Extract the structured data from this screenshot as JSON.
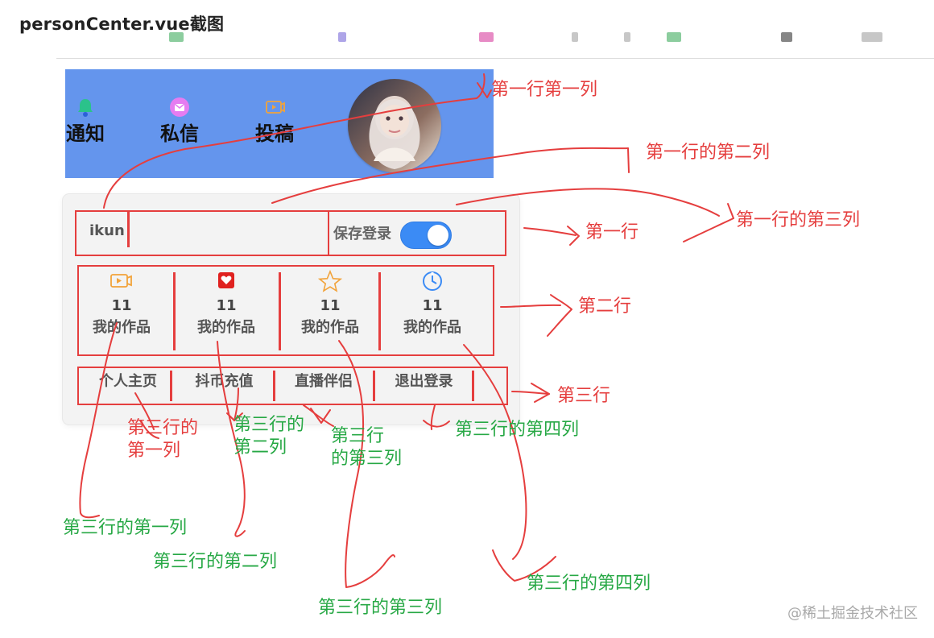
{
  "doc": {
    "title": "personCenter.vue截图"
  },
  "header": {
    "items": [
      {
        "label": "通知",
        "icon": "bell-icon"
      },
      {
        "label": "私信",
        "icon": "message-icon"
      },
      {
        "label": "投稿",
        "icon": "video-upload-icon"
      }
    ],
    "avatar": {
      "icon": "avatar",
      "color": "#7f6f73"
    },
    "bg": "#6495ed"
  },
  "card": {
    "username": "ikun",
    "save_login_label": "保存登录",
    "toggle_on": true,
    "stats": [
      {
        "count": "11",
        "label": "我的作品",
        "icon": "video-icon"
      },
      {
        "count": "11",
        "label": "我的作品",
        "icon": "heart-icon"
      },
      {
        "count": "11",
        "label": "我的作品",
        "icon": "star-icon"
      },
      {
        "count": "11",
        "label": "我的作品",
        "icon": "clock-icon"
      }
    ],
    "links": [
      {
        "label": "个人主页"
      },
      {
        "label": "抖币充值"
      },
      {
        "label": "直播伴侣"
      },
      {
        "label": "退出登录"
      }
    ]
  },
  "annotations": {
    "r1c1": "第一行第一列",
    "r1c2": "第一行的第二列",
    "r1": "第一行",
    "r1c3": "第一行的第三列",
    "r2": "第二行",
    "r3": "第三行",
    "r3c1_red": "第三行的\n第一列",
    "r3c2_green": "第三行的\n第二列",
    "r3c3_green": "第三行\n的第三列",
    "r3c4_green": "第三行的第四列",
    "r3c1_bottom": "第三行的第一列",
    "r3c2_bottom": "第三行的第二列",
    "r3c3_bottom": "第三行的第三列",
    "r3c4_bottom": "第三行的第四列"
  },
  "watermark": {
    "text": "@稀土掘金技术社区"
  },
  "colors": {
    "annotation_red": "#e53e3e",
    "annotation_green": "#27a845",
    "toggle_blue": "#3b8bf5",
    "panel_blue": "#6495ed"
  }
}
